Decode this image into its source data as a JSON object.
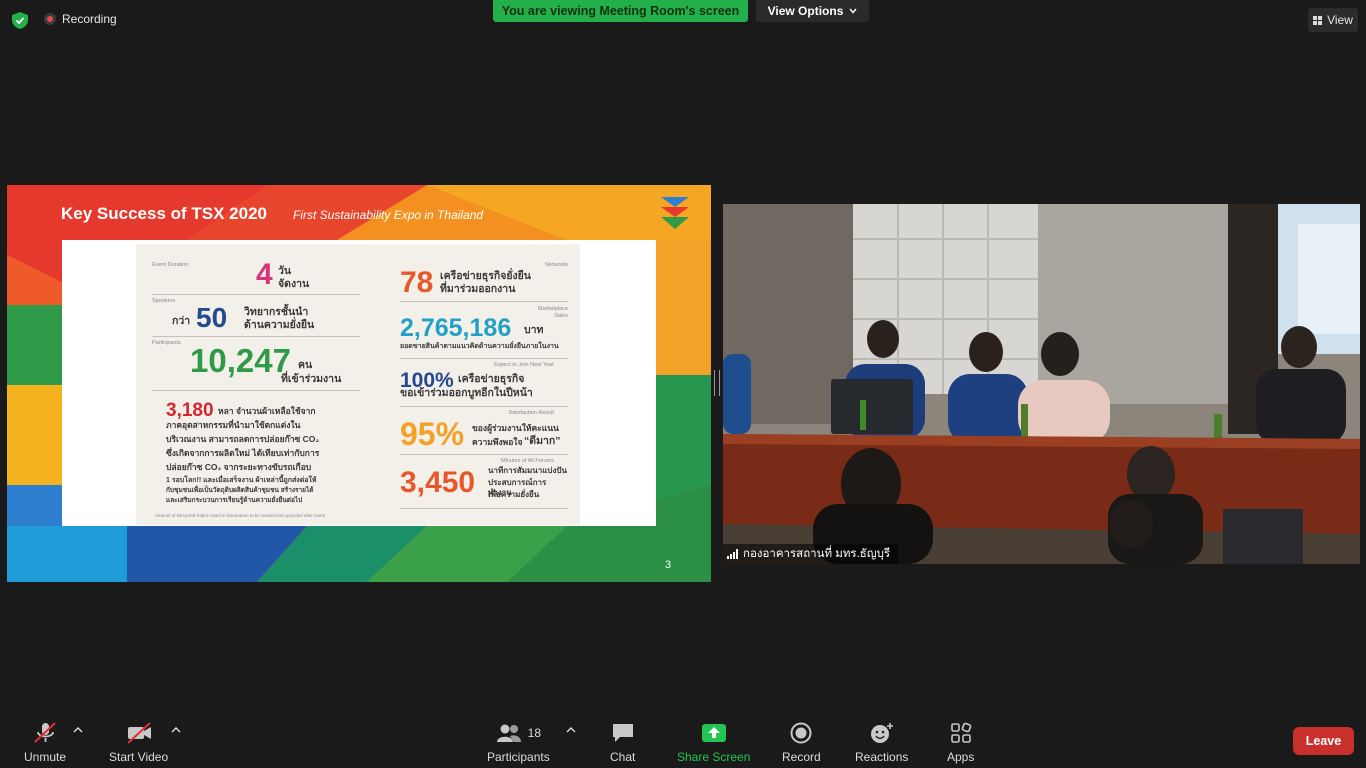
{
  "top_bar": {
    "recording_label": "Recording",
    "viewing_banner": "You are viewing Meeting Room's screen",
    "view_options_label": "View Options",
    "view_label": "View"
  },
  "shared_slide": {
    "title": "Key Success of TSX 2020",
    "subtitle": "First Sustainability Expo in Thailand",
    "page_number": "3",
    "left_column": {
      "duration_caption": "Event Duration",
      "duration_value": "4",
      "duration_unit_line1": "วัน",
      "duration_unit_line2": "จัดงาน",
      "speakers_caption": "Speakers",
      "speakers_prefix": "กว่า",
      "speakers_value": "50",
      "speakers_text_line1": "วิทยากรชั้นนำ",
      "speakers_text_line2": "ด้านความยั่งยืน",
      "participants_caption": "Participants",
      "participants_value": "10,247",
      "participants_unit": "คน",
      "participants_text": "ที่เข้าร่วมงาน",
      "fabric_value": "3,180",
      "fabric_text_line1": "หลา จำนวนผ้าเหลือใช้จาก",
      "fabric_text_line2": "ภาคอุตสาหกรรมที่นำมาใช้ตกแต่งใน",
      "fabric_text_line3": "บริเวณงาน สามารถลดการปล่อยก๊าซ CO₂",
      "fabric_text_line4": "ซึ่งเกิดจากการผลิตใหม่ ได้เทียบเท่ากับการ",
      "fabric_text_line5": "ปล่อยก๊าซ CO₂ จากระยะทางขับรถเกือบ",
      "fabric_text_line6": "1 รอบโลก!! และเมื่อเสร็จงาน ผ้าเหล่านี้ถูกส่งต่อให้",
      "fabric_text_line7": "กับชุมชนเพื่อเป็นวัตถุดิบผลิตสินค้าชุมชน สร้างรายได้",
      "fabric_text_line8": "และเสริมกระบวนการเรียนรู้ด้านความยั่งยืนต่อไป",
      "footnote": "Amount of Recycled Fabric Used in Decoration to be reused and upcycled after event"
    },
    "right_column": {
      "networks_caption": "Networks",
      "networks_value": "78",
      "networks_text_line1": "เครือข่ายธุรกิจยั่งยืน",
      "networks_text_line2": "ที่มาร่วมออกงาน",
      "sales_caption_line1": "Marketplace",
      "sales_caption_line2": "Sales",
      "sales_value": "2,765,186",
      "sales_unit": "บาท",
      "sales_text": "ยอดขายสินค้าตามแนวคิดด้านความยั่งยืนภายในงาน",
      "next_year_caption": "Expect to Join Next Year",
      "next_year_value": "100%",
      "next_year_text_line1": "เครือข่ายธุรกิจ",
      "next_year_text_line2": "ขอเข้าร่วมออกบูทอีกในปีหน้า",
      "satisfaction_caption": "Satisfaction Result",
      "satisfaction_value": "95%",
      "satisfaction_text_line1": "ของผู้ร่วมงานให้คะแนน",
      "satisfaction_text_line2": "ความพึงพอใจ",
      "satisfaction_text_emph": "“ดีมาก”",
      "forums_caption": "Minutes of All Forums",
      "forums_value": "3,450",
      "forums_text_line1": "นาทีการสัมมนาแบ่งปัน",
      "forums_text_line2": "ประสบการณ์การทำงาน",
      "forums_text_line3": "เพื่อความยั่งยืน"
    }
  },
  "video": {
    "participant_name": "กองอาคารสถานที่ มทร.ธัญบุรี"
  },
  "toolbar": {
    "unmute_label": "Unmute",
    "start_video_label": "Start Video",
    "participants_label": "Participants",
    "participants_count": "18",
    "chat_label": "Chat",
    "share_screen_label": "Share Screen",
    "record_label": "Record",
    "reactions_label": "Reactions",
    "apps_label": "Apps",
    "leave_label": "Leave"
  },
  "colors": {
    "banner_green": "#23b04b",
    "leave_red": "#c9302c",
    "share_green": "#23c552"
  }
}
